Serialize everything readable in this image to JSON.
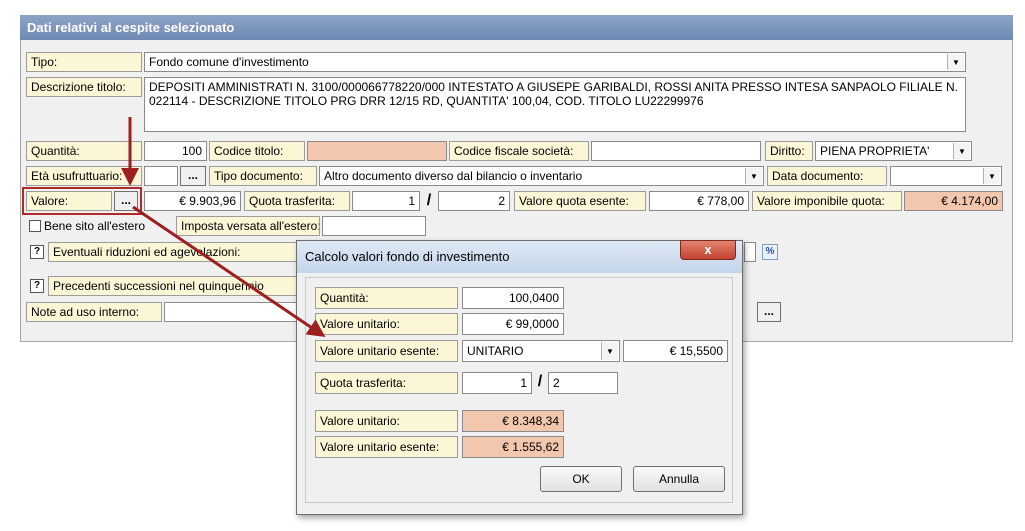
{
  "panel": {
    "title": "Dati relativi al cespite selezionato"
  },
  "form": {
    "tipo_label": "Tipo:",
    "tipo_value": "Fondo comune d'investimento",
    "descrizione_label": "Descrizione titolo:",
    "descrizione_value": "DEPOSITI AMMINISTRATI  N. 3100/000066778220/000 INTESTATO A GIUSEPE GARIBALDI, ROSSI ANITA PRESSO INTESA SANPAOLO FILIALE N. 022114 - DESCRIZIONE TITOLO PRG DRR 12/15 RD,  QUANTITA' 100,04, COD. TITOLO LU22299976",
    "quantita_label": "Quantità:",
    "quantita_value": "100",
    "codice_titolo_label": "Codice titolo:",
    "codice_titolo_value": "",
    "codice_fiscale_label": "Codice fiscale società:",
    "codice_fiscale_value": "",
    "diritto_label": "Diritto:",
    "diritto_value": "PIENA PROPRIETA'",
    "eta_label": "Età usufruttuario:",
    "tipo_documento_label": "Tipo documento:",
    "tipo_documento_value": "Altro documento diverso dal bilancio o inventario",
    "data_documento_label": "Data documento:",
    "data_documento_value": "",
    "valore_label": "Valore:",
    "valore_value": "€ 9.903,96",
    "quota_trasferita_label": "Quota trasferita:",
    "quota_num": "1",
    "quota_den": "2",
    "valore_quota_esente_label": "Valore quota esente:",
    "valore_quota_esente_value": "€ 778,00",
    "valore_imponibile_label": "Valore imponibile quota:",
    "valore_imponibile_value": "€ 4.174,00",
    "bene_estero_label": "Bene sito all'estero",
    "imposta_estero_label": "Imposta versata all'estero:",
    "riduzioni_label": "Eventuali riduzioni ed agevolazioni:",
    "precedenti_label": "Precedenti successioni nel quinquennio",
    "note_label": "Note ad uso interno:",
    "ellipsis": "...",
    "percent_icon_text": "%"
  },
  "dialog": {
    "title": "Calcolo valori fondo di investimento",
    "close": "x",
    "quantita_label": "Quantità:",
    "quantita_value": "100,0400",
    "valore_unitario_label": "Valore unitario:",
    "valore_unitario_value": "€ 99,0000",
    "valore_unitario_esente_label": "Valore unitario esente:",
    "esente_type": "UNITARIO",
    "esente_value": "€ 15,5500",
    "quota_trasferita_label": "Quota trasferita:",
    "quota_num": "1",
    "quota_den": "2",
    "result_unitario_label": "Valore unitario:",
    "result_unitario_value": "€ 8.348,34",
    "result_esente_label": "Valore unitario esente:",
    "result_esente_value": "€ 1.555,62",
    "ok_label": "OK",
    "cancel_label": "Annulla"
  },
  "colors": {
    "label_bg": "#fbf6d6",
    "computed_bg": "#f2c7ad",
    "title_bar": "#7b93bc",
    "annotation_red": "#9e1f1f"
  }
}
